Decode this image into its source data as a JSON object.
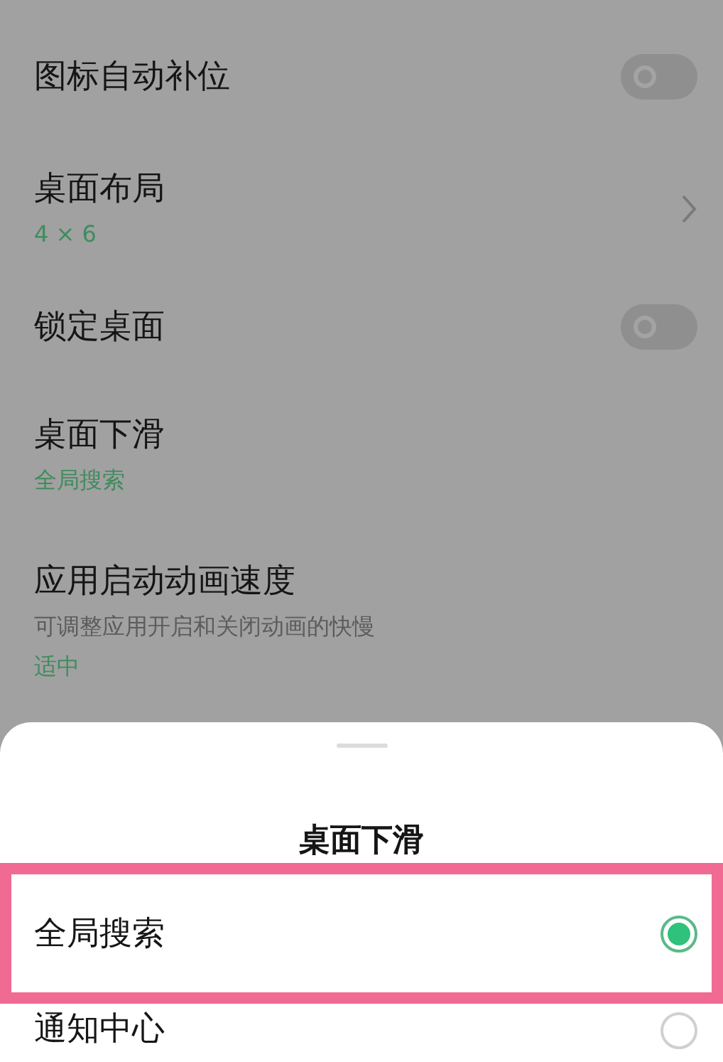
{
  "settings": [
    {
      "kind": "toggle",
      "title": "图标自动补位",
      "on": false
    },
    {
      "kind": "nav",
      "title": "桌面布局",
      "value": "4 × 6"
    },
    {
      "kind": "toggle",
      "title": "锁定桌面",
      "on": false
    },
    {
      "kind": "plain",
      "title": "桌面下滑",
      "value": "全局搜索"
    },
    {
      "kind": "plain",
      "title": "应用启动动画速度",
      "description": "可调整应用开启和关闭动画的快慢",
      "value": "适中"
    }
  ],
  "sheet": {
    "title": "桌面下滑",
    "options": [
      {
        "label": "全局搜索",
        "selected": true,
        "highlighted": true
      },
      {
        "label": "通知中心",
        "selected": false,
        "highlighted": false
      }
    ]
  }
}
